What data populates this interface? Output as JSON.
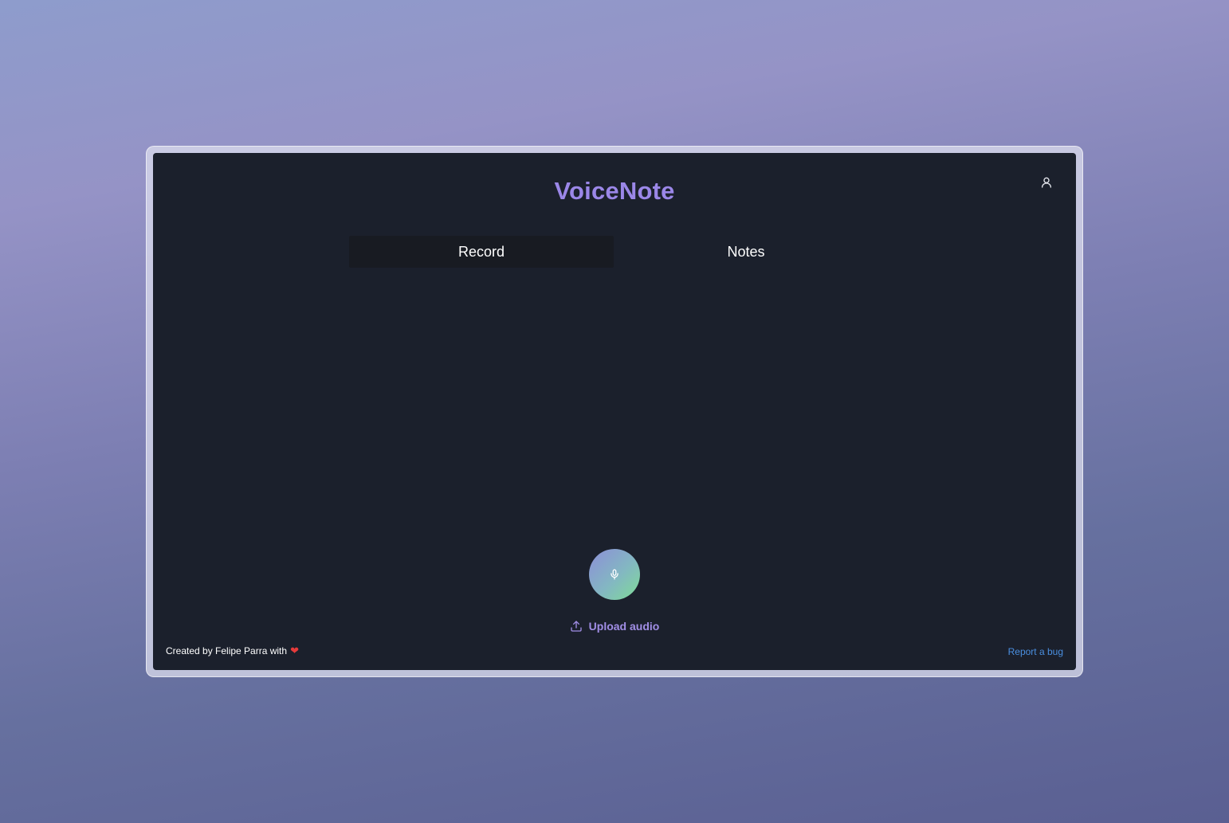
{
  "app": {
    "title": "VoiceNote"
  },
  "tabs": [
    {
      "label": "Record",
      "active": true
    },
    {
      "label": "Notes",
      "active": false
    }
  ],
  "record": {
    "mic_icon": "microphone-icon",
    "upload_icon": "upload-icon",
    "upload_label": "Upload audio"
  },
  "header": {
    "user_icon": "user-icon"
  },
  "footer": {
    "credit_text": "Created by Felipe Parra with",
    "credit_icon": "heart-icon",
    "report_link": "Report a bug"
  },
  "colors": {
    "accent": "#9b87e8",
    "link": "#4a8fe0",
    "background": "#1b202c",
    "heart": "#e53b3b"
  }
}
